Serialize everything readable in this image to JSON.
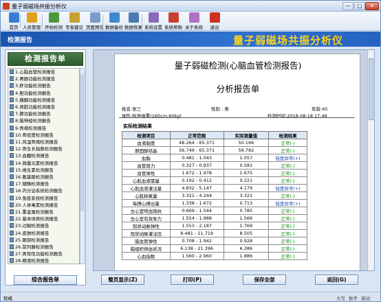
{
  "window": {
    "title": "量子弱磁场共振分析仪",
    "min": "—",
    "max": "□",
    "close": "✕"
  },
  "toolbar": [
    {
      "label": "首页",
      "icon": "home-icon",
      "color": "#3b7bd4"
    },
    {
      "label": "人员管理",
      "icon": "users-icon",
      "color": "#e0a020"
    },
    {
      "label": "开始检测",
      "icon": "start-test-icon",
      "color": "#4a9a3a"
    },
    {
      "label": "专家建议",
      "icon": "expert-icon",
      "color": "#c8a030"
    },
    {
      "label": "页面预览",
      "icon": "preview-icon",
      "color": "#7a9ac8"
    },
    {
      "label": "数据备份",
      "icon": "backup-icon",
      "color": "#3a8ad0"
    },
    {
      "label": "数据恢复",
      "icon": "restore-icon",
      "color": "#4a7ab0"
    },
    {
      "label": "系统设置",
      "icon": "settings-icon",
      "color": "#8a6ab8"
    },
    {
      "label": "系统帮助",
      "icon": "help-icon",
      "color": "#c84030"
    },
    {
      "label": "关于系统",
      "icon": "about-icon",
      "color": "#b070c0"
    },
    {
      "label": "退出",
      "icon": "exit-icon",
      "color": "#d03020"
    }
  ],
  "band": {
    "left": "检测报告",
    "right": "量子弱磁场共振分析仪"
  },
  "sidebar": {
    "heading": "检测报告单",
    "summary_button": "综合报告单",
    "items": [
      "1.心脑血管检测报告",
      "2.胃肠功能检测报告",
      "3.肝功能检测报告",
      "4.胆功能检测报告",
      "5.胰腺功能检测报告",
      "6.肾脏功能检测报告",
      "7.肺功能检测报告",
      "8.脑神经检测报告",
      "9.骨病检测报告",
      "10.骨密度检测报告",
      "11.风湿骨病检测报告",
      "12.骨生长指数检测报告",
      "13.血糖检测报告",
      "14.微量元素检测报告",
      "15.维生素检测报告",
      "16.氨基酸检测报告",
      "17.辅酶检测报告",
      "18.内分泌系统检测报告",
      "19.免疫系统检测报告",
      "20.人体毒素检测报告",
      "21.重金属检测报告",
      "22.基本体质检测报告",
      "23.过敏检测报告",
      "24.皮肤检测报告",
      "25.眼部检测报告",
      "26.前列腺检测报告",
      "27.男性性功能检测报告",
      "28.精液检测报告"
    ]
  },
  "report": {
    "title": "量子弱磁检测(心脑血管检测报告)",
    "subtitle": "分析报告单",
    "name": "姓名:张三",
    "gender": "性别 : 男",
    "age": "年龄:45",
    "body": "体形:标准体重(160cm,60kg)",
    "time": "检测时间:2018-08-18 17:49",
    "section": "实际检测结果",
    "headers": [
      "检测项目",
      "正常范围",
      "实际测量值",
      "检测结果"
    ],
    "rows": [
      [
        "血液黏度",
        "48.264 - 65.371",
        "50.166",
        "正常(-)"
      ],
      [
        "胆固醇结晶",
        "56.749 - 65.371",
        "56.782",
        "正常(-)"
      ],
      [
        "血脂",
        "0.481 - 1.043",
        "1.057",
        "轻度异常(+)"
      ],
      [
        "血管阻力",
        "0.327 - 0.937",
        "0.581",
        "正常(-)"
      ],
      [
        "血管弹性",
        "1.672 - 1.978",
        "1.675",
        "正常(-)"
      ],
      [
        "心肌血液需量",
        "0.192 - 0.412",
        "0.221",
        "正常(-)"
      ],
      [
        "心肌血液灌注量",
        "4.832 - 5.147",
        "4.179",
        "轻度异常(+)"
      ],
      [
        "心肌耗氧量",
        "3.321 - 4.244",
        "3.321",
        "正常(-)"
      ],
      [
        "每搏心搏出量",
        "1.338 - 1.672",
        "0.713",
        "轻度异常(+)"
      ],
      [
        "左心室喷血阻抗",
        "0.669 - 1.544",
        "0.785",
        "正常(-)"
      ],
      [
        "左心室有效泵力",
        "1.554 - 1.988",
        "1.566",
        "正常(-)"
      ],
      [
        "冠状动脉弹性",
        "1.553 - 2.187",
        "1.769",
        "正常(-)"
      ],
      [
        "冠状动脉灌注压",
        "8.481 - 11.719",
        "8.505",
        "正常(-)"
      ],
      [
        "脑血管弹性",
        "0.708 - 1.942",
        "0.928",
        "正常(-)"
      ],
      [
        "脑组织供血状况",
        "6.138 - 21.396",
        "6.386",
        "正常(-)"
      ],
      [
        "心血指数",
        "1.560 - 2.960",
        "1.886",
        "正常(-)"
      ]
    ]
  },
  "buttons": {
    "zoom": "整页显示(Z)",
    "print": "打印(P)",
    "save": "保存全部",
    "back": "返回(G)"
  },
  "status": {
    "left": "就绪",
    "caps": "大写",
    "num": "数字",
    "scroll": "滚动"
  }
}
